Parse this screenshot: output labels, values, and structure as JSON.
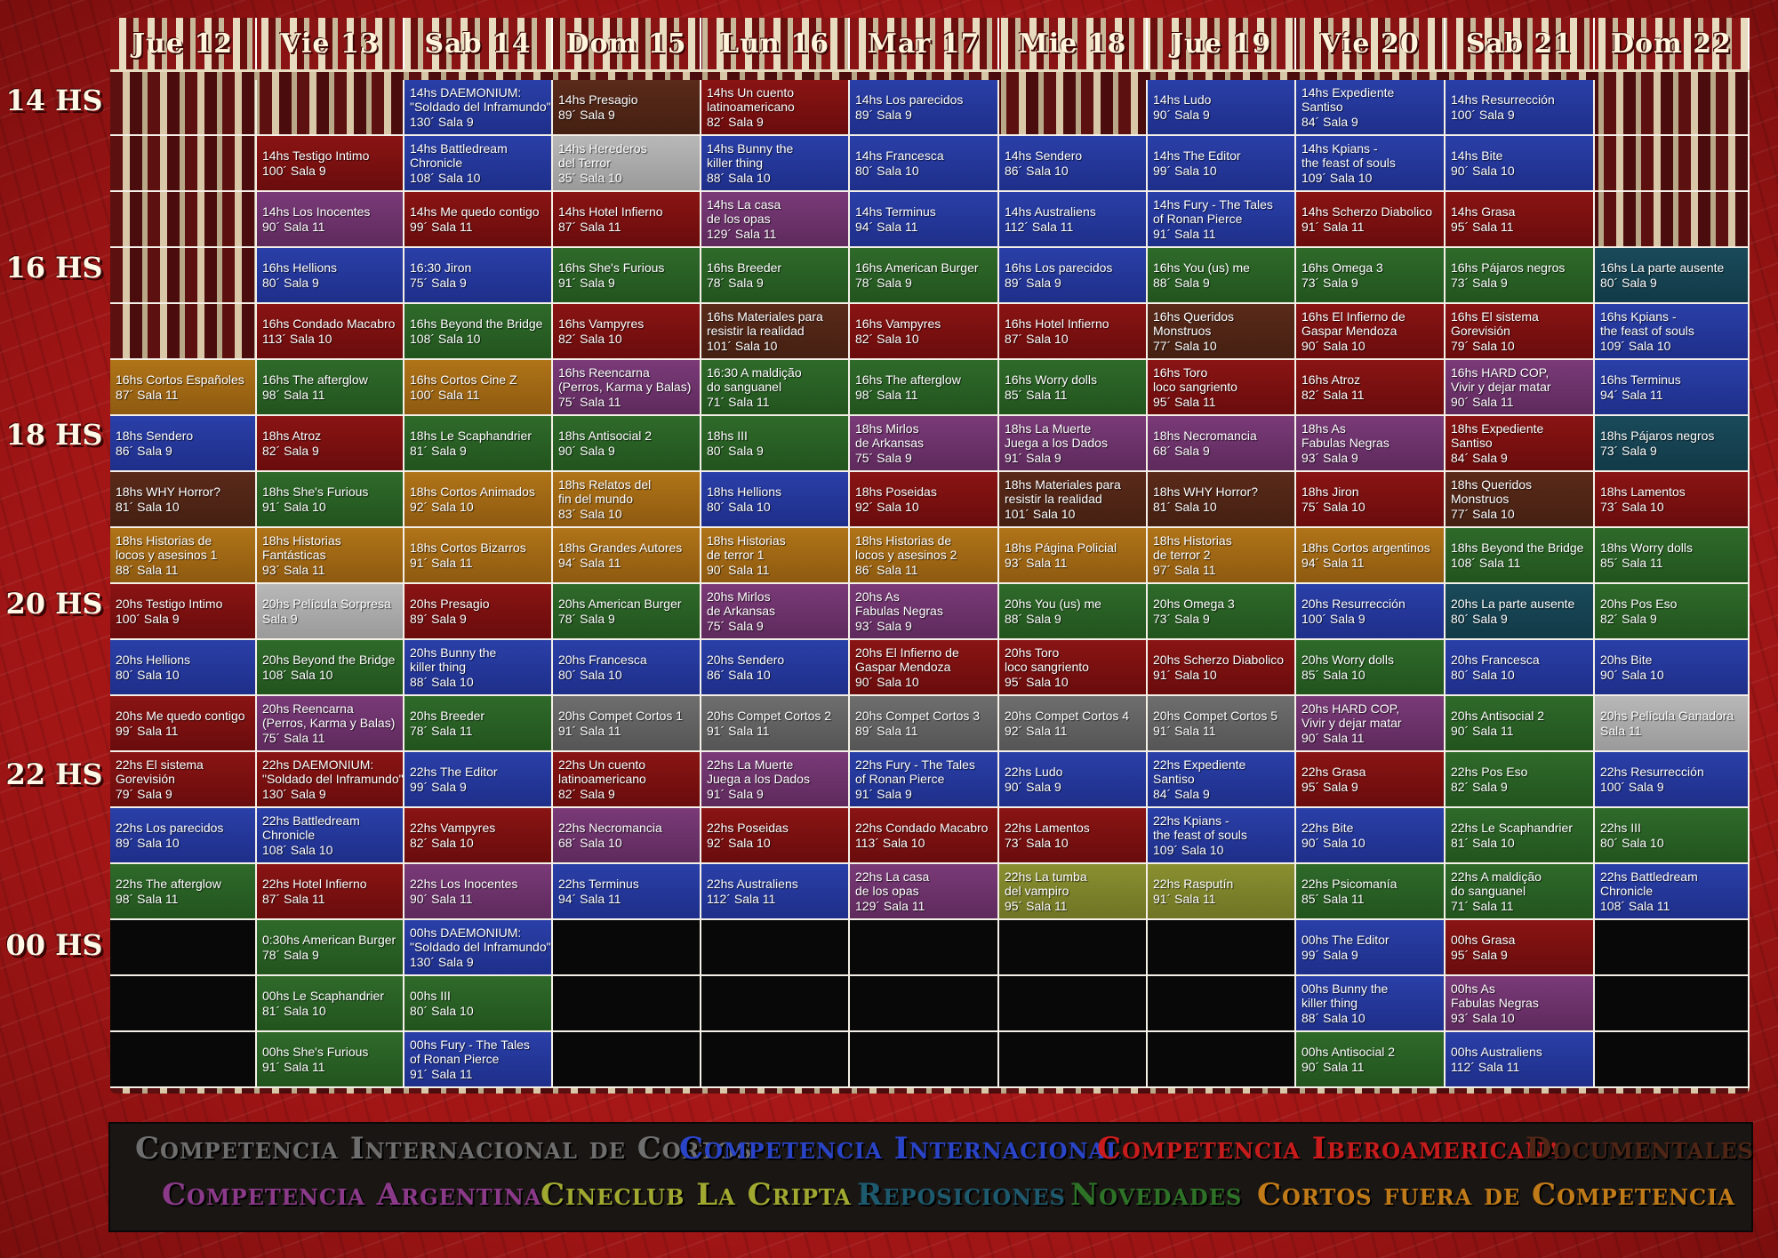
{
  "days": [
    "Jue 12",
    "Vie 13",
    "Sab 14",
    "Dom 15",
    "Lun 16",
    "Mar 17",
    "Mie 18",
    "Jue 19",
    "Vie 20",
    "Sab 21",
    "Dom 22"
  ],
  "hours": [
    "14 HS",
    "16 HS",
    "18 HS",
    "20 HS",
    "22 HS",
    "00 HS"
  ],
  "colors": {
    "gray": "#5e5e5e",
    "blue": "#2438a0",
    "red": "#7a1010",
    "brown": "#4f2616",
    "purple": "#6e3270",
    "olive": "#7e8428",
    "teal": "#16414f",
    "green": "#286224",
    "orange": "#a06812",
    "silver": "#a8a8a8"
  },
  "schedule": [
    [
      "",
      "",
      [
        "blue",
        "14hs DAEMONIUM:",
        "\"Soldado del Inframundo\"",
        "130´ Sala 9"
      ],
      [
        "brown",
        "14hs Presagio",
        "89´ Sala 9"
      ],
      [
        "red",
        "14hs Un cuento",
        "latinoamericano",
        "82´ Sala 9"
      ],
      [
        "blue",
        "14hs Los parecidos",
        "89´ Sala 9"
      ],
      "",
      [
        "blue",
        "14hs Ludo",
        "90´ Sala 9"
      ],
      [
        "blue",
        "14hs Expediente",
        "Santiso",
        "84´ Sala 9"
      ],
      [
        "blue",
        "14hs Resurrección",
        "100´ Sala 9"
      ],
      ""
    ],
    [
      "",
      [
        "red",
        "14hs Testigo Intimo",
        "100´ Sala 9"
      ],
      [
        "blue",
        "14hs Battledream",
        "Chronicle",
        "108´ Sala 10"
      ],
      [
        "silver",
        "14hs Herederos",
        "del Terror",
        "35´ Sala 10"
      ],
      [
        "blue",
        "14hs Bunny the",
        "killer thing",
        "88´ Sala 10"
      ],
      [
        "blue",
        "14hs Francesca",
        "80´ Sala 10"
      ],
      [
        "blue",
        "14hs Sendero",
        "86´ Sala 10"
      ],
      [
        "blue",
        "14hs The Editor",
        "99´ Sala 10"
      ],
      [
        "blue",
        "14hs Kpians -",
        "the feast of souls",
        "109´ Sala 10"
      ],
      [
        "blue",
        "14hs Bite",
        "90´ Sala 10"
      ],
      ""
    ],
    [
      "",
      [
        "purple",
        "14hs Los Inocentes",
        "90´ Sala 11"
      ],
      [
        "red",
        "14hs Me quedo contigo",
        "99´ Sala 11"
      ],
      [
        "red",
        "14hs Hotel Infierno",
        "87´ Sala 11"
      ],
      [
        "purple",
        "14hs La casa",
        "de los opas",
        "129´ Sala 11"
      ],
      [
        "blue",
        "14hs Terminus",
        "94´ Sala 11"
      ],
      [
        "blue",
        "14hs Australiens",
        "112´ Sala 11"
      ],
      [
        "blue",
        "14hs Fury - The Tales",
        "of Ronan Pierce",
        "91´ Sala 11"
      ],
      [
        "red",
        "14hs Scherzo Diabolico",
        "91´ Sala 11"
      ],
      [
        "red",
        "14hs Grasa",
        "95´ Sala 11"
      ],
      ""
    ],
    [
      "",
      [
        "blue",
        "16hs Hellions",
        "80´ Sala 9"
      ],
      [
        "blue",
        "16:30 Jiron",
        "75´ Sala 9"
      ],
      [
        "green",
        "16hs She's Furious",
        "91´ Sala 9"
      ],
      [
        "green",
        "16hs Breeder",
        "78´ Sala 9"
      ],
      [
        "green",
        "16hs American Burger",
        "78´ Sala 9"
      ],
      [
        "blue",
        "16hs Los parecidos",
        "89´ Sala 9"
      ],
      [
        "green",
        "16hs You (us) me",
        "88´ Sala 9"
      ],
      [
        "green",
        "16hs Omega 3",
        "73´ Sala 9"
      ],
      [
        "green",
        "16hs Pájaros negros",
        "73´ Sala 9"
      ],
      [
        "teal",
        "16hs La parte ausente",
        "80´ Sala 9"
      ]
    ],
    [
      "",
      [
        "red",
        "16hs Condado Macabro",
        "113´ Sala 10"
      ],
      [
        "green",
        "16hs Beyond the Bridge",
        "108´ Sala 10"
      ],
      [
        "red",
        "16hs Vampyres",
        "82´ Sala 10"
      ],
      [
        "brown",
        "16hs Materiales para",
        "resistir la realidad",
        "101´ Sala 10"
      ],
      [
        "red",
        "16hs Vampyres",
        "82´ Sala 10"
      ],
      [
        "red",
        "16hs Hotel Infierno",
        "87´ Sala 10"
      ],
      [
        "brown",
        "16hs Queridos",
        "Monstruos",
        "77´ Sala 10"
      ],
      [
        "red",
        "16hs El Infierno de",
        "Gaspar Mendoza",
        "90´ Sala 10"
      ],
      [
        "red",
        "16hs El sistema",
        "Gorevisión",
        "79´ Sala 10"
      ],
      [
        "blue",
        "16hs Kpians -",
        "the feast of souls",
        "109´ Sala 10"
      ]
    ],
    [
      [
        "orange",
        "16hs Cortos Españoles",
        "87´ Sala 11"
      ],
      [
        "green",
        "16hs The afterglow",
        "98´ Sala 11"
      ],
      [
        "orange",
        "16hs Cortos Cine Z",
        "100´ Sala 11"
      ],
      [
        "purple",
        "16hs Reencarna",
        "(Perros, Karma y Balas)",
        "75´ Sala 11"
      ],
      [
        "green",
        "16:30 A maldição",
        "do sanguanel",
        "71´ Sala 11"
      ],
      [
        "green",
        "16hs The afterglow",
        "98´ Sala 11"
      ],
      [
        "green",
        "16hs Worry dolls",
        "85´ Sala 11"
      ],
      [
        "red",
        "16hs Toro",
        "loco sangriento",
        "95´ Sala 11"
      ],
      [
        "red",
        "16hs Atroz",
        "82´ Sala 11"
      ],
      [
        "purple",
        "16hs HARD COP,",
        "Vivir y dejar matar",
        "90´ Sala 11"
      ],
      [
        "blue",
        "16hs Terminus",
        "94´ Sala 11"
      ]
    ],
    [
      [
        "blue",
        "18hs Sendero",
        "86´ Sala 9"
      ],
      [
        "red",
        "18hs Atroz",
        "82´ Sala 9"
      ],
      [
        "green",
        "18hs Le Scaphandrier",
        "81´ Sala 9"
      ],
      [
        "green",
        "18hs Antisocial 2",
        "90´ Sala 9"
      ],
      [
        "green",
        "18hs III",
        "80´ Sala 9"
      ],
      [
        "purple",
        "18hs Mirlos",
        "de Arkansas",
        "75´ Sala 9"
      ],
      [
        "purple",
        "18hs La Muerte",
        "Juega a los Dados",
        "91´ Sala 9"
      ],
      [
        "purple",
        "18hs Necromancia",
        "68´ Sala 9"
      ],
      [
        "purple",
        "18hs As",
        "Fabulas Negras",
        "93´ Sala 9"
      ],
      [
        "red",
        "18hs Expediente",
        "Santiso",
        "84´ Sala 9"
      ],
      [
        "teal",
        "18hs Pájaros negros",
        "73´ Sala 9"
      ]
    ],
    [
      [
        "brown",
        "18hs WHY Horror?",
        "81´ Sala 10"
      ],
      [
        "green",
        "18hs She's Furious",
        "91´ Sala 10"
      ],
      [
        "orange",
        "18hs Cortos Animados",
        "92´ Sala 10"
      ],
      [
        "orange",
        "18hs Relatos del",
        "fin del mundo",
        "83´ Sala 10"
      ],
      [
        "blue",
        "18hs Hellions",
        "80´ Sala 10"
      ],
      [
        "red",
        "18hs Poseidas",
        "92´ Sala 10"
      ],
      [
        "brown",
        "18hs Materiales para",
        "resistir la realidad",
        "101´ Sala 10"
      ],
      [
        "brown",
        "18hs WHY Horror?",
        "81´ Sala 10"
      ],
      [
        "red",
        "18hs Jiron",
        "75´ Sala 10"
      ],
      [
        "brown",
        "18hs Queridos",
        "Monstruos",
        "77´ Sala 10"
      ],
      [
        "red",
        "18hs Lamentos",
        "73´ Sala 10"
      ]
    ],
    [
      [
        "orange",
        "18hs Historias de",
        "locos y asesinos 1",
        "88´ Sala 11"
      ],
      [
        "orange",
        "18hs Historias",
        "Fantásticas",
        "93´ Sala 11"
      ],
      [
        "orange",
        "18hs Cortos Bizarros",
        "91´ Sala 11"
      ],
      [
        "orange",
        "18hs Grandes Autores",
        "94´ Sala 11"
      ],
      [
        "orange",
        "18hs Historias",
        "de terror 1",
        "90´ Sala 11"
      ],
      [
        "orange",
        "18hs Historias de",
        "locos y asesinos 2",
        "86´ Sala 11"
      ],
      [
        "orange",
        "18hs Página Policial",
        "93´ Sala 11"
      ],
      [
        "orange",
        "18hs Historias",
        "de terror 2",
        "97´ Sala 11"
      ],
      [
        "orange",
        "18hs Cortos argentinos",
        "94´ Sala 11"
      ],
      [
        "green",
        "18hs Beyond the Bridge",
        "108´ Sala 11"
      ],
      [
        "green",
        "18hs Worry dolls",
        "85´ Sala 11"
      ]
    ],
    [
      [
        "red",
        "20hs Testigo Intimo",
        "100´ Sala 9"
      ],
      [
        "silver",
        "20hs Película Sorpresa",
        "Sala 9"
      ],
      [
        "red",
        "20hs Presagio",
        "89´ Sala 9"
      ],
      [
        "green",
        "20hs American Burger",
        "78´ Sala 9"
      ],
      [
        "purple",
        "20hs Mirlos",
        "de Arkansas",
        "75´ Sala 9"
      ],
      [
        "purple",
        "20hs As",
        "Fabulas Negras",
        "93´ Sala 9"
      ],
      [
        "green",
        "20hs You (us) me",
        "88´ Sala 9"
      ],
      [
        "green",
        "20hs Omega 3",
        "73´ Sala 9"
      ],
      [
        "blue",
        "20hs Resurrección",
        "100´ Sala 9"
      ],
      [
        "teal",
        "20hs La parte ausente",
        "80´ Sala 9"
      ],
      [
        "green",
        "20hs Pos Eso",
        "82´ Sala 9"
      ]
    ],
    [
      [
        "blue",
        "20hs Hellions",
        "80´ Sala 10"
      ],
      [
        "green",
        "20hs Beyond the Bridge",
        "108´ Sala 10"
      ],
      [
        "blue",
        "20hs Bunny the",
        "killer thing",
        "88´ Sala 10"
      ],
      [
        "blue",
        "20hs Francesca",
        "80´ Sala 10"
      ],
      [
        "blue",
        "20hs Sendero",
        "86´ Sala 10"
      ],
      [
        "red",
        "20hs El Infierno de",
        "Gaspar Mendoza",
        "90´ Sala 10"
      ],
      [
        "red",
        "20hs Toro",
        "loco sangriento",
        "95´ Sala 10"
      ],
      [
        "red",
        "20hs Scherzo Diabolico",
        "91´ Sala 10"
      ],
      [
        "green",
        "20hs Worry dolls",
        "85´ Sala 10"
      ],
      [
        "blue",
        "20hs Francesca",
        "80´ Sala 10"
      ],
      [
        "blue",
        "20hs Bite",
        "90´ Sala 10"
      ]
    ],
    [
      [
        "red",
        "20hs Me quedo contigo",
        "99´ Sala 11"
      ],
      [
        "purple",
        "20hs Reencarna",
        "(Perros, Karma y Balas)",
        "75´ Sala 11"
      ],
      [
        "green",
        "20hs Breeder",
        "78´ Sala 11"
      ],
      [
        "gray",
        "20hs Compet Cortos 1",
        "91´ Sala 11"
      ],
      [
        "gray",
        "20hs Compet Cortos 2",
        "91´ Sala 11"
      ],
      [
        "gray",
        "20hs Compet Cortos 3",
        "89´ Sala 11"
      ],
      [
        "gray",
        "20hs Compet Cortos 4",
        "92´ Sala 11"
      ],
      [
        "gray",
        "20hs Compet Cortos 5",
        "91´ Sala 11"
      ],
      [
        "purple",
        "20hs HARD COP,",
        "Vivir y dejar matar",
        "90´ Sala 11"
      ],
      [
        "green",
        "20hs Antisocial 2",
        "90´ Sala 11"
      ],
      [
        "silver",
        "20hs Película Ganadora",
        "Sala 11"
      ]
    ],
    [
      [
        "red",
        "22hs El sistema",
        "Gorevisión",
        "79´ Sala 9"
      ],
      [
        "red",
        "22hs DAEMONIUM:",
        "\"Soldado del Inframundo\"",
        "130´ Sala 9"
      ],
      [
        "blue",
        "22hs The Editor",
        "99´ Sala 9"
      ],
      [
        "red",
        "22hs Un cuento",
        "latinoamericano",
        "82´ Sala 9"
      ],
      [
        "purple",
        "22hs La Muerte",
        "Juega a los Dados",
        "91´ Sala 9"
      ],
      [
        "blue",
        "22hs Fury - The Tales",
        "of Ronan Pierce",
        "91´ Sala 9"
      ],
      [
        "blue",
        "22hs Ludo",
        "90´ Sala 9"
      ],
      [
        "blue",
        "22hs Expediente",
        "Santiso",
        "84´ Sala 9"
      ],
      [
        "red",
        "22hs Grasa",
        "95´ Sala 9"
      ],
      [
        "green",
        "22hs Pos Eso",
        "82´ Sala 9"
      ],
      [
        "blue",
        "22hs Resurrección",
        "100´ Sala 9"
      ]
    ],
    [
      [
        "blue",
        "22hs Los parecidos",
        "89´ Sala 10"
      ],
      [
        "blue",
        "22hs Battledream",
        "Chronicle",
        "108´ Sala 10"
      ],
      [
        "red",
        "22hs Vampyres",
        "82´ Sala 10"
      ],
      [
        "purple",
        "22hs Necromancia",
        "68´ Sala 10"
      ],
      [
        "red",
        "22hs Poseidas",
        "92´ Sala 10"
      ],
      [
        "red",
        "22hs Condado Macabro",
        "113´ Sala 10"
      ],
      [
        "red",
        "22hs Lamentos",
        "73´ Sala 10"
      ],
      [
        "blue",
        "22hs Kpians -",
        "the feast of souls",
        "109´ Sala 10"
      ],
      [
        "blue",
        "22hs Bite",
        "90´ Sala 10"
      ],
      [
        "green",
        "22hs Le Scaphandrier",
        "81´ Sala 10"
      ],
      [
        "green",
        "22hs III",
        "80´ Sala 10"
      ]
    ],
    [
      [
        "green",
        "22hs The afterglow",
        "98´ Sala 11"
      ],
      [
        "red",
        "22hs Hotel Infierno",
        "87´ Sala 11"
      ],
      [
        "purple",
        "22hs Los Inocentes",
        "90´ Sala 11"
      ],
      [
        "blue",
        "22hs Terminus",
        "94´ Sala 11"
      ],
      [
        "blue",
        "22hs Australiens",
        "112´ Sala 11"
      ],
      [
        "purple",
        "22hs La casa",
        "de los opas",
        "129´ Sala 11"
      ],
      [
        "olive",
        "22hs La tumba",
        "del vampiro",
        "95´ Sala 11"
      ],
      [
        "olive",
        "22hs Rasputín",
        "91´ Sala 11"
      ],
      [
        "green",
        "22hs Psicomanía",
        "85´ Sala 11"
      ],
      [
        "green",
        "22hs A maldição",
        "do sanguanel",
        "71´ Sala 11"
      ],
      [
        "blue",
        "22hs Battledream",
        "Chronicle",
        "108´ Sala 11"
      ]
    ],
    [
      "black",
      [
        "green",
        "0:30hs American Burger",
        "78´ Sala 9"
      ],
      [
        "blue",
        "00hs DAEMONIUM:",
        "\"Soldado del Inframundo\"",
        "130´ Sala 9"
      ],
      "black",
      "black",
      "black",
      "black",
      "black",
      [
        "blue",
        "00hs The Editor",
        "99´ Sala 9"
      ],
      [
        "red",
        "00hs Grasa",
        "95´ Sala 9"
      ],
      "black"
    ],
    [
      "black",
      [
        "green",
        "00hs Le Scaphandrier",
        "81´ Sala 10"
      ],
      [
        "green",
        "00hs III",
        "80´ Sala 10"
      ],
      "black",
      "black",
      "black",
      "black",
      "black",
      [
        "blue",
        "00hs Bunny the",
        "killer thing",
        "88´ Sala 10"
      ],
      [
        "purple",
        "00hs As",
        "Fabulas Negras",
        "93´ Sala 10"
      ],
      "black"
    ],
    [
      "black",
      [
        "green",
        "00hs She's Furious",
        "91´ Sala 11"
      ],
      [
        "blue",
        "00hs Fury - The Tales",
        "of Ronan Pierce",
        "91´ Sala 11"
      ],
      "black",
      "black",
      "black",
      "black",
      "black",
      [
        "green",
        "00hs Antisocial 2",
        "90´ Sala 11"
      ],
      [
        "blue",
        "00hs Australiens",
        "112´ Sala 11"
      ],
      "black"
    ]
  ],
  "legend": [
    {
      "label": "Competencia Internacional de Cortos",
      "color": "#6e6e6e"
    },
    {
      "label": "Competencia Internacional",
      "color": "#2a44c8"
    },
    {
      "label": "Competencia Iberoamericana",
      "color": "#c81c1c"
    },
    {
      "label": "Documentales",
      "color": "#4f2616"
    },
    {
      "label": "Competencia Argentina",
      "color": "#8a3a88"
    },
    {
      "label": "Cineclub La Cripta",
      "color": "#a0a830"
    },
    {
      "label": "Reposiciones",
      "color": "#1e5a6e"
    },
    {
      "label": "Novedades",
      "color": "#2e7228"
    },
    {
      "label": "Cortos fuera de Competencia",
      "color": "#c07a18"
    }
  ]
}
